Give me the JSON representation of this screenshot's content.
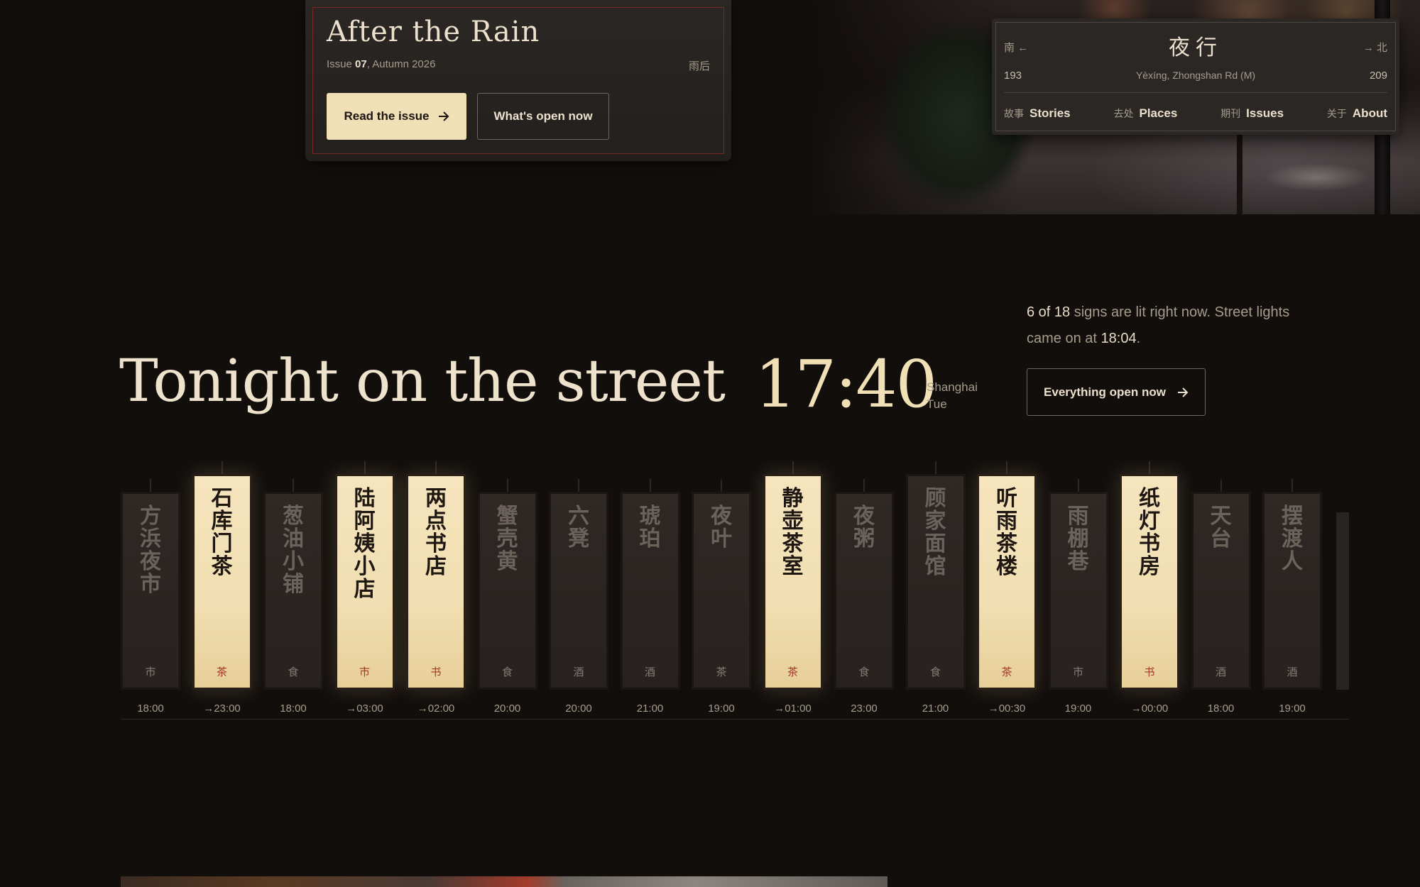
{
  "issue_card": {
    "title": "After the Rain",
    "meta_prefix": "Issue ",
    "issue_number": "07",
    "meta_suffix": ", Autumn 2026",
    "cn_label": "雨后",
    "read_button": "Read the issue",
    "open_button": "What's open now"
  },
  "nav": {
    "south": "南 ←",
    "north": "→ 北",
    "logo": "夜行",
    "number_left": "193",
    "number_right": "209",
    "address": "Yèxíng, Zhongshan Rd (M)",
    "links": [
      {
        "cn": "故事",
        "en": "Stories"
      },
      {
        "cn": "去处",
        "en": "Places"
      },
      {
        "cn": "期刊",
        "en": "Issues"
      },
      {
        "cn": "关于",
        "en": "About"
      }
    ]
  },
  "tonight": {
    "title": "Tonight on the street",
    "clock": "17:40",
    "city": "Shanghai",
    "day": "Tue",
    "status": {
      "lit_count": "6 of 18",
      "text_1": " signs are lit right now. Street lights came on at ",
      "lights_time": "18:04",
      "text_2": "."
    },
    "everything_button": "Everything open now"
  },
  "signs": [
    {
      "name": "方浜夜市",
      "category": "市",
      "time": "18:00",
      "lit": false
    },
    {
      "name": "石库门茶",
      "category": "茶",
      "time": "→23:00",
      "lit": true
    },
    {
      "name": "葱油小铺",
      "category": "食",
      "time": "18:00",
      "lit": false
    },
    {
      "name": "陆阿姨小店",
      "category": "市",
      "time": "→03:00",
      "lit": true
    },
    {
      "name": "两点书店",
      "category": "书",
      "time": "→02:00",
      "lit": true
    },
    {
      "name": "蟹壳黄",
      "category": "食",
      "time": "20:00",
      "lit": false
    },
    {
      "name": "六凳",
      "category": "酒",
      "time": "20:00",
      "lit": false
    },
    {
      "name": "琥珀",
      "category": "酒",
      "time": "21:00",
      "lit": false
    },
    {
      "name": "夜叶",
      "category": "茶",
      "time": "19:00",
      "lit": false
    },
    {
      "name": "静壶茶室",
      "category": "茶",
      "time": "→01:00",
      "lit": true
    },
    {
      "name": "夜粥",
      "category": "食",
      "time": "23:00",
      "lit": false
    },
    {
      "name": "顾家面馆",
      "category": "食",
      "time": "21:00",
      "lit": false
    },
    {
      "name": "听雨茶楼",
      "category": "茶",
      "time": "→00:30",
      "lit": true
    },
    {
      "name": "雨棚巷",
      "category": "市",
      "time": "19:00",
      "lit": false
    },
    {
      "name": "纸灯书房",
      "category": "书",
      "time": "→00:00",
      "lit": true
    },
    {
      "name": "天台",
      "category": "酒",
      "time": "18:00",
      "lit": false
    },
    {
      "name": "摆渡人",
      "category": "酒",
      "time": "19:00",
      "lit": false
    }
  ],
  "icons": {
    "arrow": "arrow-right-icon"
  }
}
